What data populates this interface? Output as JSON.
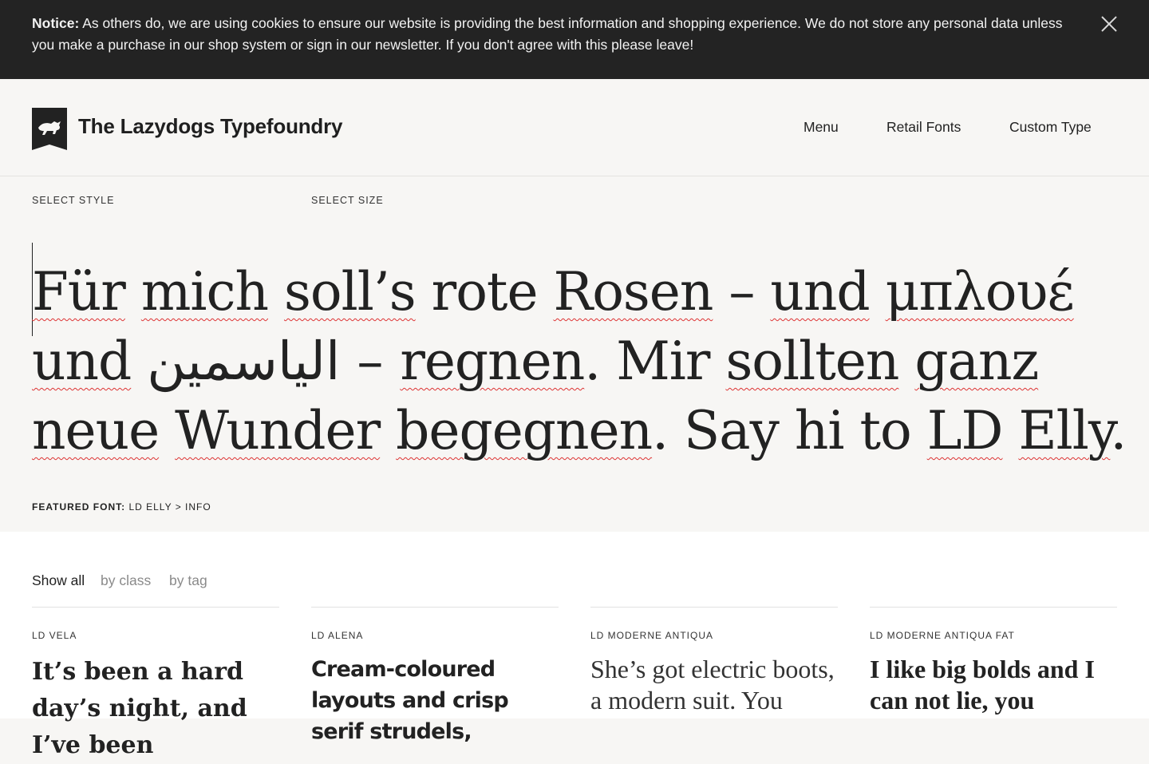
{
  "cookie": {
    "label": "Notice:",
    "text": " As others do, we are using cookies to ensure our website is providing the best information and shopping experience. We do not store any personal data unless you make a purchase in our shop system or sign in our newsletter. If you don't agree with this please leave!"
  },
  "header": {
    "brand": "The Lazydogs Typefoundry",
    "nav": [
      "Menu",
      "Retail Fonts",
      "Custom Type"
    ]
  },
  "controls": {
    "select_style": "SELECT STYLE",
    "select_size": "SELECT SIZE"
  },
  "specimen": {
    "words": [
      {
        "t": "Für",
        "sq": true
      },
      {
        "t": " "
      },
      {
        "t": "mich",
        "sq": true
      },
      {
        "t": " "
      },
      {
        "t": "soll’s",
        "sq": true
      },
      {
        "t": " rote "
      },
      {
        "t": "Rosen",
        "sq": true
      },
      {
        "t": " – "
      },
      {
        "t": "und",
        "sq": true
      },
      {
        "t": " "
      },
      {
        "t": "μπλουέ",
        "sq": true
      },
      {
        "t": " "
      },
      {
        "t": "und",
        "sq": true
      },
      {
        "t": " الياسمين – "
      },
      {
        "t": "regnen",
        "sq": true
      },
      {
        "t": ". Mir "
      },
      {
        "t": "sollten",
        "sq": true
      },
      {
        "t": " "
      },
      {
        "t": "ganz",
        "sq": true
      },
      {
        "t": " "
      },
      {
        "t": "neue",
        "sq": true
      },
      {
        "t": " "
      },
      {
        "t": "Wunder",
        "sq": true
      },
      {
        "t": " "
      },
      {
        "t": "begegnen",
        "sq": true
      },
      {
        "t": ". Say hi to "
      },
      {
        "t": "LD",
        "sq": true
      },
      {
        "t": " "
      },
      {
        "t": "Elly",
        "sq": true
      },
      {
        "t": "."
      }
    ]
  },
  "featured": {
    "label": "FEATURED FONT:",
    "value": " LD ELLY > INFO"
  },
  "filters": [
    "Show all",
    "by class",
    "by tag"
  ],
  "cards": [
    {
      "name": "LD VELA",
      "sample": "It’s been a hard day’s night, and I’ve been"
    },
    {
      "name": "LD ALENA",
      "sample": "Cream-coloured layouts and crisp serif strudels,"
    },
    {
      "name": "LD MODERNE ANTIQUA",
      "sample": "She’s got electric boots, a modern suit. You"
    },
    {
      "name": "LD MODERNE ANTIQUA FAT",
      "sample": "I like big bolds and I can not lie, you"
    }
  ],
  "colors": {
    "cookie_bg": "#232323",
    "page_bg": "#f7f6f4",
    "muted": "#8a8a8a",
    "spell_underline": "#dd3333"
  }
}
